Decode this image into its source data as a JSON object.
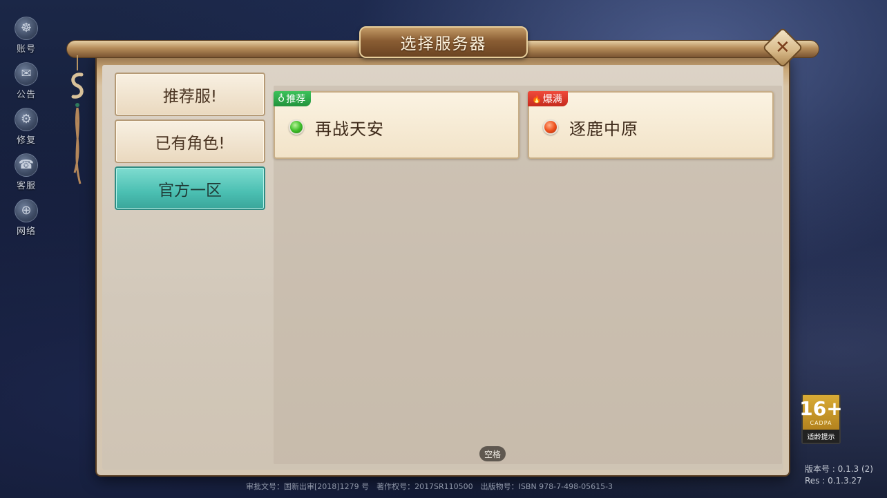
{
  "sidebar": {
    "items": [
      {
        "label": "账号",
        "icon": "account-icon",
        "glyph": "☸"
      },
      {
        "label": "公告",
        "icon": "announcement-icon",
        "glyph": "✉"
      },
      {
        "label": "修复",
        "icon": "repair-icon",
        "glyph": "⚙"
      },
      {
        "label": "客服",
        "icon": "customer-service-icon",
        "glyph": "☎"
      },
      {
        "label": "网络",
        "icon": "network-icon",
        "glyph": "⊕"
      }
    ]
  },
  "dialog": {
    "title": "选择服务器",
    "close_glyph": "✕",
    "tabs": [
      {
        "label": "推荐服!",
        "active": false
      },
      {
        "label": "已有角色!",
        "active": false
      },
      {
        "label": "官方一区",
        "active": true
      }
    ],
    "servers": [
      {
        "badge": "推荐",
        "badge_glyph": "♁",
        "status": "green",
        "name": "再战天安"
      },
      {
        "badge": "爆满",
        "badge_glyph": "🔥",
        "status": "red",
        "name": "逐鹿中原"
      }
    ],
    "space_key_label": "空格"
  },
  "footer": {
    "approval": "审批文号：国新出审[2018]1279 号　著作权号：2017SR110500　出版物号：ISBN 978-7-498-05615-3",
    "version": "版本号 : 0.1.3 (2)",
    "res": "Res : 0.1.3.27"
  },
  "age_rating": {
    "value": "16+",
    "org": "CADPA",
    "tip": "适龄提示"
  },
  "colors": {
    "active_tab": "#4bbfb2",
    "recommend_badge": "#22933c",
    "full_badge": "#c52b1e",
    "status_green": "#3fbf2a",
    "status_red": "#f0521e"
  }
}
